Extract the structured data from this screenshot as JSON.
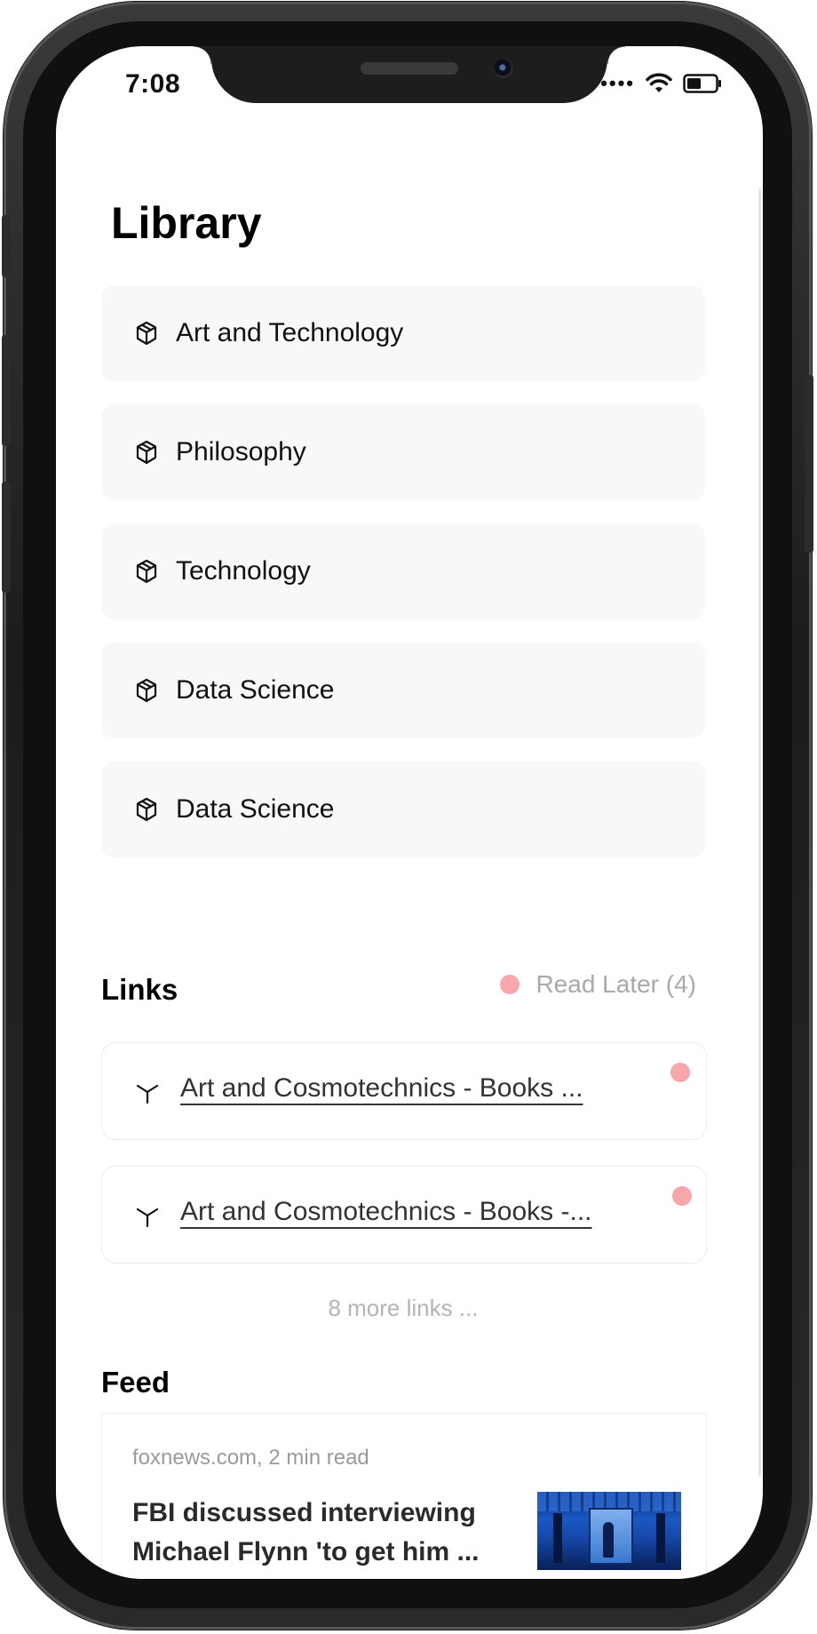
{
  "status_bar": {
    "time": "7:08",
    "signal": "••••"
  },
  "library": {
    "title": "Library",
    "items": [
      {
        "label": "Art and Technology"
      },
      {
        "label": "Philosophy"
      },
      {
        "label": "Technology"
      },
      {
        "label": "Data Science"
      },
      {
        "label": "Data Science"
      }
    ]
  },
  "links": {
    "title": "Links",
    "read_later": "Read Later (4)",
    "items": [
      {
        "title": "Art and Cosmotechnics - Books ..."
      },
      {
        "title": "Art and Cosmotechnics - Books -..."
      }
    ],
    "more": "8 more links ..."
  },
  "feed": {
    "title": "Feed",
    "items": [
      {
        "meta": "foxnews.com, 2 min read",
        "title": "FBI discussed interviewing Michael Flynn 'to get him ..."
      }
    ]
  },
  "colors": {
    "card_bg": "#f6f9f8",
    "unread_dot": "#f7a6aa",
    "muted_text": "#a9a9a9"
  },
  "icons": {
    "category": "cube-icon",
    "link": "branch-icon",
    "battery": "battery-icon",
    "wifi": "wifi-icon"
  }
}
